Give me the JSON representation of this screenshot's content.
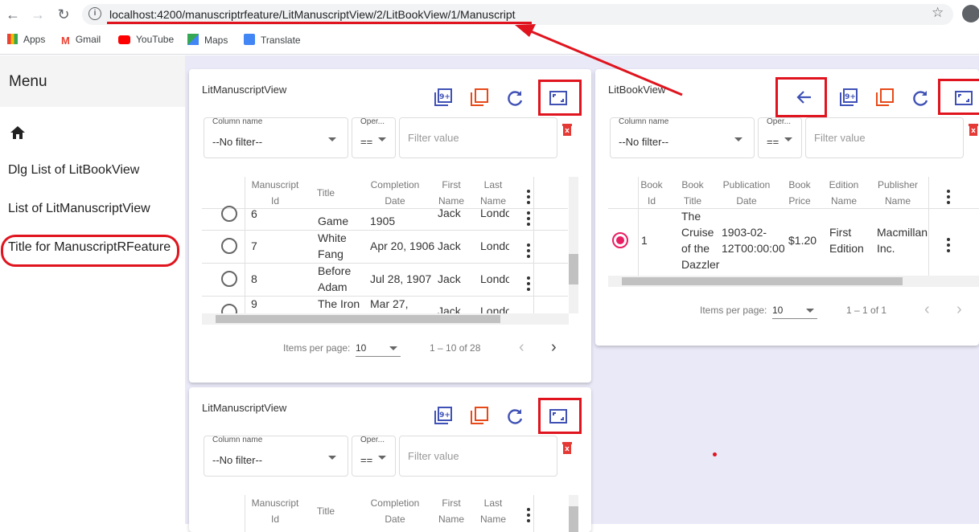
{
  "browser": {
    "url": "localhost:4200/manuscriptrfeature/LitManuscriptView/2/LitBookView/1/Manuscript",
    "bookmarks": [
      "Apps",
      "Gmail",
      "YouTube",
      "Maps",
      "Translate"
    ]
  },
  "sidebar": {
    "title": "Menu",
    "items": [
      "Dlg List of LitBookView",
      "List of LitManuscriptView",
      "Title for ManuscriptRFeature"
    ]
  },
  "manuscript_panel": {
    "title": "LitManuscriptView",
    "filter": {
      "column_label": "Column name",
      "column_value": "--No filter--",
      "operator_label": "Oper...",
      "operator_value": "==",
      "value_placeholder": "Filter value"
    },
    "columns": [
      "Manuscript Id",
      "Title",
      "Completion Date",
      "First Name",
      "Last Name"
    ],
    "rows": [
      {
        "id": "6",
        "title": "Game",
        "date": "1905",
        "first": "Jack",
        "last": "Londo"
      },
      {
        "id": "7",
        "title": "White Fang",
        "date": "Apr 20, 1906",
        "first": "Jack",
        "last": "Londo"
      },
      {
        "id": "8",
        "title": "Before Adam",
        "date": "Jul 28, 1907",
        "first": "Jack",
        "last": "Londo"
      },
      {
        "id": "9",
        "title": "The Iron",
        "date": "Mar 27,",
        "first": "Jack",
        "last": "Londo"
      }
    ],
    "paginator": {
      "items_label": "Items per page:",
      "page_size": "10",
      "range": "1 – 10 of 28"
    }
  },
  "book_panel": {
    "title": "LitBookView",
    "filter": {
      "column_label": "Column name",
      "column_value": "--No filter--",
      "operator_label": "Oper...",
      "operator_value": "==",
      "value_placeholder": "Filter value"
    },
    "columns": [
      "Book Id",
      "Book Title",
      "Publication Date",
      "Book Price",
      "Edition Name",
      "Publisher Name"
    ],
    "row": {
      "id": "1",
      "title": "The Cruise of the Dazzler",
      "date": "1903-02-12T00:00:00",
      "price": "$1.20",
      "edition": "First Edition",
      "publisher": "Macmillan Inc."
    },
    "paginator": {
      "items_label": "Items per page:",
      "page_size": "10",
      "range": "1 – 1 of 1"
    }
  },
  "manuscript_panel_2": {
    "title": "LitManuscriptView",
    "filter": {
      "column_label": "Column name",
      "column_value": "--No filter--",
      "operator_label": "Oper...",
      "operator_value": "==",
      "value_placeholder": "Filter value"
    },
    "columns": [
      "Manuscript Id",
      "Title",
      "Completion Date",
      "First Name",
      "Last Name"
    ]
  },
  "colors": {
    "annotation": "#e0141e",
    "accent": "#3f51b5",
    "danger": "#e53935"
  }
}
